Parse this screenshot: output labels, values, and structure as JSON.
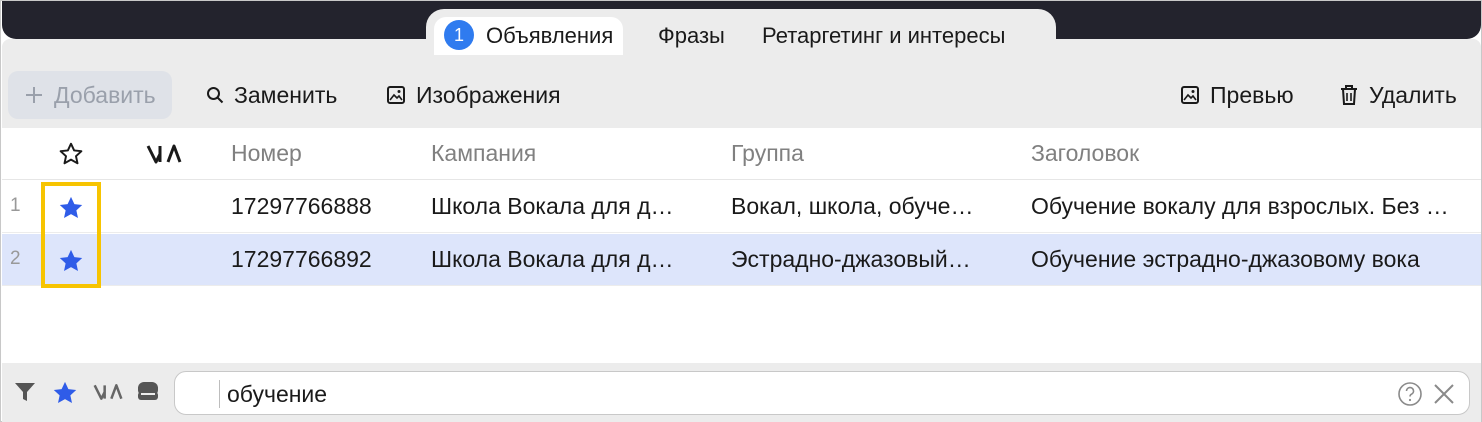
{
  "tabs": [
    {
      "label": "Объявления",
      "badge": "1",
      "active": true
    },
    {
      "label": "Фразы"
    },
    {
      "label": "Ретаргетинг и интересы"
    }
  ],
  "toolbar": {
    "add_label": "Добавить",
    "replace_label": "Заменить",
    "images_label": "Изображения",
    "preview_label": "Превью",
    "delete_label": "Удалить"
  },
  "table": {
    "columns": [
      "Номер",
      "Кампания",
      "Группа",
      "Заголовок"
    ],
    "rows": [
      {
        "index": "1",
        "starred": true,
        "number": "17297766888",
        "campaign": "Школа Вокала для д…",
        "group": "Вокал, школа, обуче…",
        "title": "Обучение вокалу для взрослых. Без …"
      },
      {
        "index": "2",
        "starred": true,
        "selected": true,
        "number": "17297766892",
        "campaign": "Школа Вокала для д…",
        "group": "Эстрадно-джазовый…",
        "title": "Обучение эстрадно-джазовому вока"
      }
    ]
  },
  "filter": {
    "search_value": "обучение"
  },
  "colors": {
    "accent": "#2f5ce8",
    "badge": "#2f7bef",
    "highlight": "#f7c400",
    "selected_row": "#dde5fb",
    "topbar": "#23232d"
  }
}
